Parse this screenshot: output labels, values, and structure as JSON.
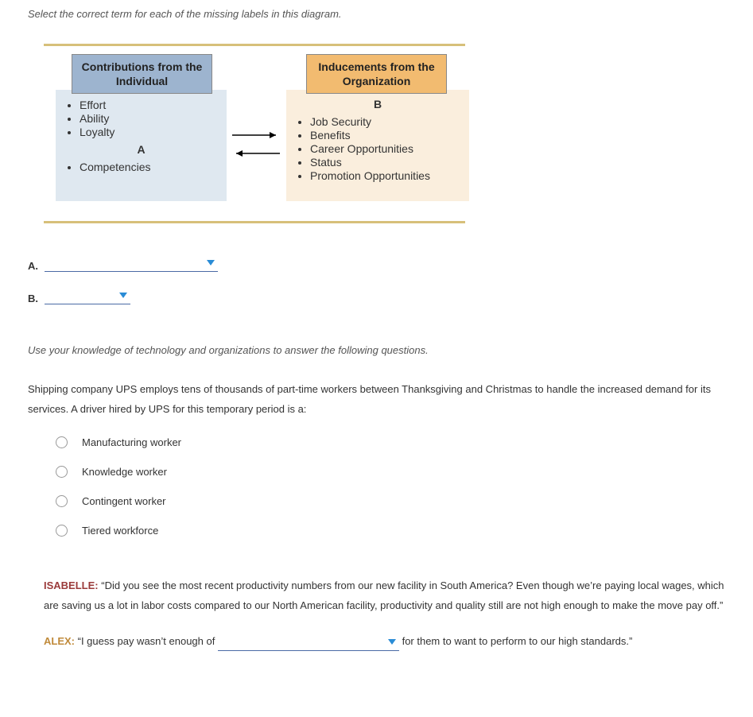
{
  "instruction1": "Select the correct term for each of the missing labels in this diagram.",
  "diagram": {
    "left_header": "Contributions from the Individual",
    "right_header": "Inducements from the Organization",
    "left_items_top": [
      "Effort",
      "Ability",
      "Loyalty"
    ],
    "left_blank": "A",
    "left_items_bottom": [
      "Competencies"
    ],
    "right_blank": "B",
    "right_items": [
      "Job Security",
      "Benefits",
      "Career Opportunities",
      "Status",
      "Promotion Opportunities"
    ]
  },
  "answers": {
    "a_label": "A.",
    "b_label": "B."
  },
  "instruction2": "Use your knowledge of technology and organizations to answer the following questions.",
  "q2_text": "Shipping company UPS employs tens of thousands of part-time workers between Thanksgiving and Christmas to handle the increased demand for its services. A driver hired by UPS for this temporary period is a:",
  "q2_options": [
    "Manufacturing worker",
    "Knowledge worker",
    "Contingent worker",
    "Tiered workforce"
  ],
  "dialogue": {
    "isabelle_name": "ISABELLE:",
    "isabelle_text": "“Did you see the most recent productivity numbers from our new facility in South America? Even though we’re paying local wages, which are saving us a lot in labor costs compared to our North American facility, productivity and quality still are not high enough to make the move pay off.”",
    "alex_name": "ALEX:",
    "alex_pre": "“I guess pay wasn’t enough of ",
    "alex_post": " for them to want to perform to our high standards.”"
  }
}
